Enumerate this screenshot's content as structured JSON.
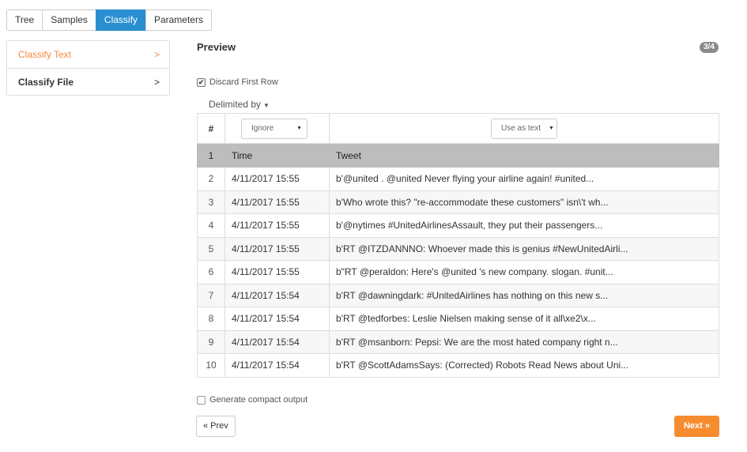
{
  "tabs": [
    {
      "label": "Tree"
    },
    {
      "label": "Samples"
    },
    {
      "label": "Classify"
    },
    {
      "label": "Parameters"
    }
  ],
  "sidebar": {
    "items": [
      {
        "label": "Classify Text",
        "chevron": ">"
      },
      {
        "label": "Classify File",
        "chevron": ">"
      }
    ]
  },
  "preview": {
    "title": "Preview",
    "badge": "3/4",
    "discard_first_row": "Discard First Row",
    "delimited_by": "Delimited by"
  },
  "table": {
    "hash_header": "#",
    "col1_select": "Ignore",
    "col2_select": "Use as text",
    "header_row": {
      "num": "1",
      "time": "Time",
      "tweet": "Tweet"
    },
    "rows": [
      {
        "num": "2",
        "time": "4/11/2017 15:55",
        "tweet": "b'@united . @united Never flying your airline again! #united..."
      },
      {
        "num": "3",
        "time": "4/11/2017 15:55",
        "tweet": "b'Who wrote this? \"re-accommodate these customers\" isn\\'t wh..."
      },
      {
        "num": "4",
        "time": "4/11/2017 15:55",
        "tweet": "b'@nytimes #UnitedAirlinesAssault, they put their passengers..."
      },
      {
        "num": "5",
        "time": "4/11/2017 15:55",
        "tweet": "b'RT @ITZDANNNO: Whoever made this is genius #NewUnitedAirli..."
      },
      {
        "num": "6",
        "time": "4/11/2017 15:55",
        "tweet": "b\"RT @peraldon: Here's @united 's new company. slogan. #unit..."
      },
      {
        "num": "7",
        "time": "4/11/2017 15:54",
        "tweet": "b'RT @dawningdark: #UnitedAirlines has nothing on this new s..."
      },
      {
        "num": "8",
        "time": "4/11/2017 15:54",
        "tweet": "b'RT @tedforbes: Leslie Nielsen making sense of it all\\xe2\\x..."
      },
      {
        "num": "9",
        "time": "4/11/2017 15:54",
        "tweet": "b'RT @msanborn: Pepsi: We are the most hated company right n..."
      },
      {
        "num": "10",
        "time": "4/11/2017 15:54",
        "tweet": "b'RT @ScottAdamsSays: (Corrected) Robots Read News about Uni..."
      }
    ]
  },
  "compact_output": "Generate compact output",
  "buttons": {
    "prev": "« Prev",
    "next": "Next »"
  },
  "colors": {
    "accent_blue": "#2a8fd1",
    "accent_orange": "#f68c2e",
    "header_gray": "#bdbdbd"
  }
}
